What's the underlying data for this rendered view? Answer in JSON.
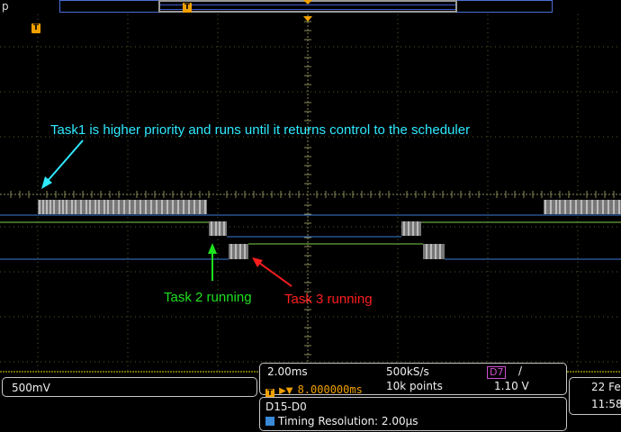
{
  "topbar": {
    "left_text": "p",
    "trigger_marker": "T"
  },
  "trigger_marker_left": "T",
  "annotations": {
    "task1": "Task1 is higher priority and runs until it returns control to the scheduler",
    "task2": "Task 2 running",
    "task3": "Task 3 running"
  },
  "status": {
    "channel_scale": "500mV",
    "timebase": "2.00ms",
    "trigger_position": "8.000000ms",
    "sample_rate": "500kS/s",
    "record_length": "10k points",
    "trigger_source": "D7",
    "trigger_slope": "/",
    "trigger_level": "1.10 V",
    "bus_label": "D15-D0",
    "timing_resolution": "Timing Resolution: 2.00µs",
    "date": "22 Fe",
    "time": "11:58"
  },
  "colors": {
    "cyan_annotation": "#2ee9ff",
    "green_annotation": "#1ee11e",
    "red_annotation": "#ff1e1e",
    "trigger_orange": "#f0a000",
    "trace_blue": "#3d7bd9",
    "trace_green": "#7fd04a",
    "d7_magenta": "#d04fd0"
  }
}
